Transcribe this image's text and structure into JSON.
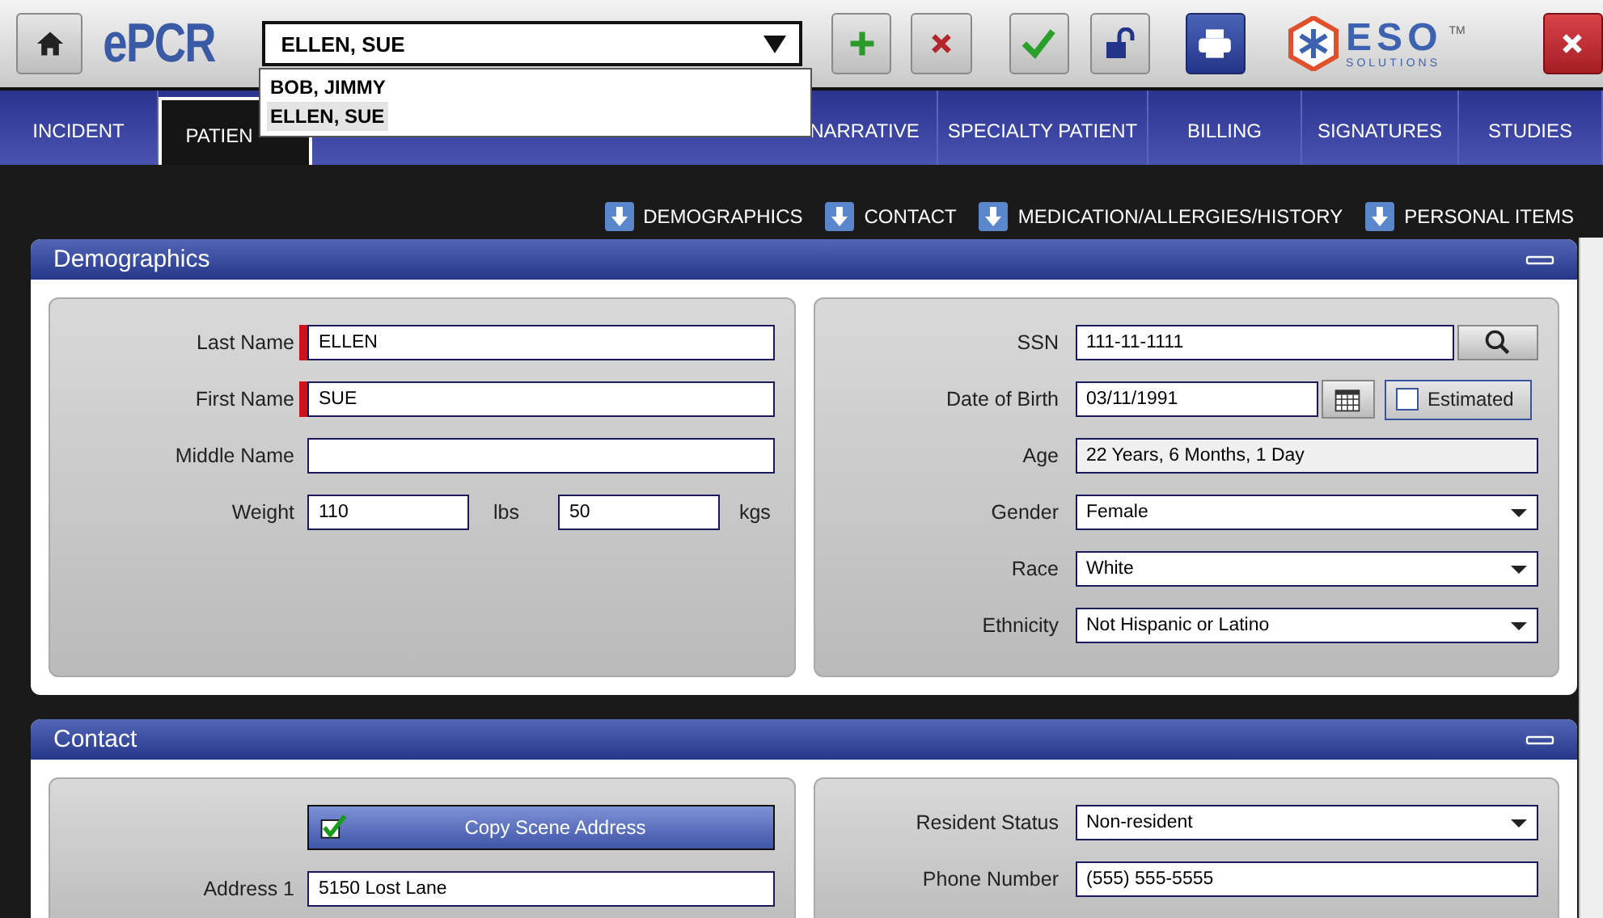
{
  "toolbar": {
    "app_logo": "ePCR",
    "patient_select": {
      "value": "ELLEN, SUE",
      "options": [
        {
          "label": "BOB, JIMMY",
          "selected": false
        },
        {
          "label": "ELLEN, SUE",
          "selected": true
        }
      ]
    },
    "vendor_logo": {
      "name": "ESO",
      "tagline": "SOLUTIONS",
      "mark": "TM"
    }
  },
  "tabs": [
    {
      "label": "INCIDENT",
      "selected": false
    },
    {
      "label": "PATIEN",
      "selected": true
    },
    {
      "label": "NARRATIVE",
      "selected": false
    },
    {
      "label": "SPECIALTY PATIENT",
      "selected": false
    },
    {
      "label": "BILLING",
      "selected": false
    },
    {
      "label": "SIGNATURES",
      "selected": false
    },
    {
      "label": "STUDIES",
      "selected": false
    }
  ],
  "jump_links": [
    "DEMOGRAPHICS",
    "CONTACT",
    "MEDICATION/ALLERGIES/HISTORY",
    "PERSONAL ITEMS"
  ],
  "sections": [
    {
      "title": "Demographics",
      "columns": [
        [
          {
            "kind": "text",
            "label": "Last Name",
            "value": "ELLEN",
            "required": true
          },
          {
            "kind": "text",
            "label": "First Name",
            "value": "SUE",
            "required": true
          },
          {
            "kind": "text",
            "label": "Middle Name",
            "required": false
          },
          {
            "kind": "weight",
            "label": "Weight",
            "value": "110",
            "unit": "lbs",
            "value_2": "50",
            "unit_2": "kgs"
          }
        ],
        [
          {
            "kind": "ssn",
            "label": "SSN",
            "value": "111-11-1111"
          },
          {
            "kind": "dob",
            "label": "Date of Birth",
            "value": "03/11/1991",
            "checkbox_label": "Estimated",
            "checked": false
          },
          {
            "kind": "readonly",
            "label": "Age",
            "value": "22 Years, 6 Months, 1 Day"
          },
          {
            "kind": "select",
            "label": "Gender",
            "value": "Female"
          },
          {
            "kind": "select",
            "label": "Race",
            "value": "White"
          },
          {
            "kind": "select",
            "label": "Ethnicity",
            "value": "Not Hispanic or Latino"
          }
        ]
      ]
    },
    {
      "title": "Contact",
      "columns": [
        [
          {
            "kind": "button",
            "label": "Copy Scene Address"
          },
          {
            "kind": "text",
            "label": "Address 1",
            "value": "5150 Lost Lane",
            "required": false
          }
        ],
        [
          {
            "kind": "select",
            "label": "Resident Status",
            "value": "Non-resident"
          },
          {
            "kind": "text",
            "label": "Phone Number",
            "value": "(555) 555-5555",
            "required": false
          }
        ]
      ]
    }
  ]
}
